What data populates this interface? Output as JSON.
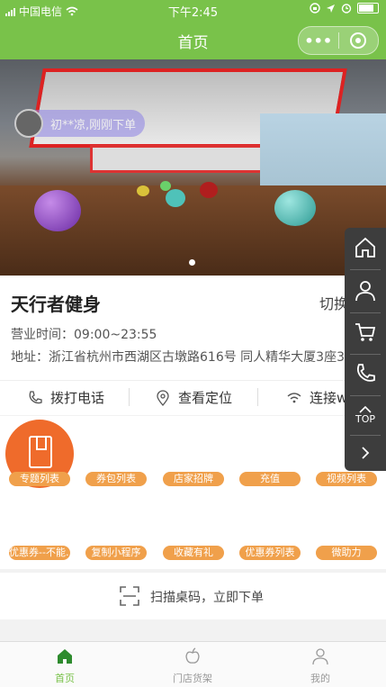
{
  "status_bar": {
    "carrier": "中国电信",
    "time": "下午2:45"
  },
  "nav": {
    "title": "首页"
  },
  "banner": {
    "toast_text": "初**凉,刚刚下单"
  },
  "store": {
    "name": "天行者健身",
    "switch_label": "切换门店",
    "hours": "营业时间：09:00~23:55",
    "address": "地址：浙江省杭州市西湖区古墩路616号 同人精华大厦3座3楼"
  },
  "actions": [
    {
      "label": "拨打电话",
      "icon": "phone-icon"
    },
    {
      "label": "查看定位",
      "icon": "location-pin-icon"
    },
    {
      "label": "连接wifi",
      "icon": "wifi-icon"
    }
  ],
  "grid_items": [
    "专题列表",
    "券包列表",
    "店家招牌",
    "充值",
    "视频列表",
    "优惠券--不能...",
    "复制小程序",
    "收藏有礼",
    "优惠券列表",
    "微助力"
  ],
  "scan": {
    "label": "扫描桌码，立即下单"
  },
  "side_menu": {
    "top_label": "TOP"
  },
  "tabbar": [
    {
      "label": "首页",
      "icon": "home-icon",
      "active": true
    },
    {
      "label": "门店货架",
      "icon": "apple-icon",
      "active": false
    },
    {
      "label": "我的",
      "icon": "person-icon",
      "active": false
    }
  ],
  "colors": {
    "brand": "#79c24a",
    "pill": "#f0a04b",
    "feature_icon": "#ef6b2b",
    "side_menu": "#3d3d3d"
  }
}
